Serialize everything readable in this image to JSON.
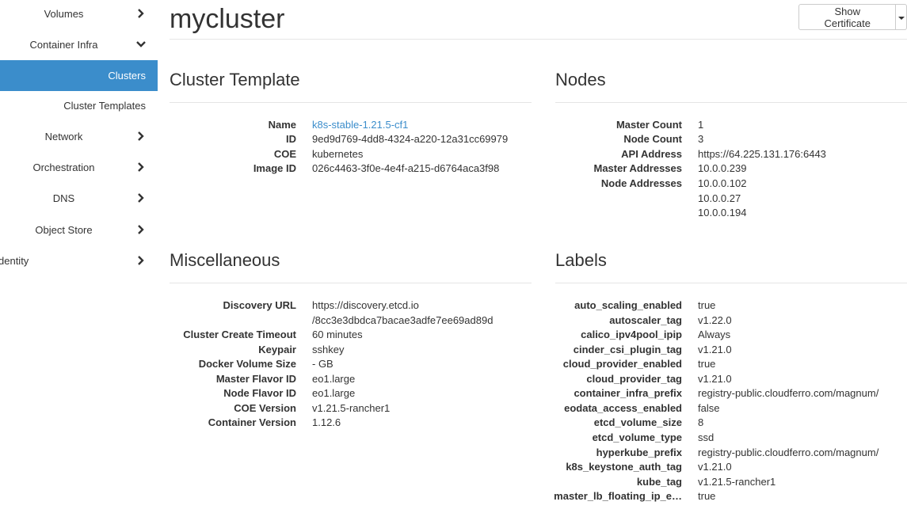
{
  "sidebar": {
    "items": [
      {
        "label": "Volumes",
        "chevron": "right"
      },
      {
        "label": "Container Infra",
        "chevron": "down"
      },
      {
        "label": "Clusters",
        "active": true
      },
      {
        "label": "Cluster Templates"
      },
      {
        "label": "Network",
        "chevron": "right"
      },
      {
        "label": "Orchestration",
        "chevron": "right"
      },
      {
        "label": "DNS",
        "chevron": "right"
      },
      {
        "label": "Object Store",
        "chevron": "right"
      },
      {
        "label": "dentity",
        "chevron": "right"
      }
    ]
  },
  "page": {
    "title": "mycluster",
    "show_certificate": "Show Certificate"
  },
  "cluster_template": {
    "title": "Cluster Template",
    "rows": [
      {
        "label": "Name",
        "value": "k8s-stable-1.21.5-cf1",
        "link": true
      },
      {
        "label": "ID",
        "value": "9ed9d769-4dd8-4324-a220-12a31cc69979"
      },
      {
        "label": "COE",
        "value": "kubernetes"
      },
      {
        "label": "Image ID",
        "value": "026c4463-3f0e-4e4f-a215-d6764aca3f98"
      }
    ]
  },
  "nodes": {
    "title": "Nodes",
    "master_count_label": "Master Count",
    "master_count": "1",
    "node_count_label": "Node Count",
    "node_count": "3",
    "api_address_label": "API Address",
    "api_address": "https://64.225.131.176:6443",
    "master_addresses_label": "Master Addresses",
    "master_addresses": [
      "10.0.0.239"
    ],
    "node_addresses_label": "Node Addresses",
    "node_addresses": [
      "10.0.0.102",
      "10.0.0.27",
      "10.0.0.194"
    ]
  },
  "misc": {
    "title": "Miscellaneous",
    "discovery_url_label": "Discovery URL",
    "discovery_url_line1": "https://discovery.etcd.io",
    "discovery_url_line2": "/8cc3e3dbdca7bacae3adfe7ee69ad89d",
    "rows": [
      {
        "label": "Cluster Create Timeout",
        "value": "60 minutes"
      },
      {
        "label": "Keypair",
        "value": "sshkey"
      },
      {
        "label": "Docker Volume Size",
        "value": "- GB"
      },
      {
        "label": "Master Flavor ID",
        "value": "eo1.large"
      },
      {
        "label": "Node Flavor ID",
        "value": "eo1.large"
      },
      {
        "label": "COE Version",
        "value": "v1.21.5-rancher1"
      },
      {
        "label": "Container Version",
        "value": "1.12.6"
      }
    ]
  },
  "labels": {
    "title": "Labels",
    "rows": [
      {
        "label": "auto_scaling_enabled",
        "value": "true"
      },
      {
        "label": "autoscaler_tag",
        "value": "v1.22.0"
      },
      {
        "label": "calico_ipv4pool_ipip",
        "value": "Always"
      },
      {
        "label": "cinder_csi_plugin_tag",
        "value": "v1.21.0"
      },
      {
        "label": "cloud_provider_enabled",
        "value": "true"
      },
      {
        "label": "cloud_provider_tag",
        "value": "v1.21.0"
      },
      {
        "label": "container_infra_prefix",
        "value": "registry-public.cloudferro.com/magnum/"
      },
      {
        "label": "eodata_access_enabled",
        "value": "false"
      },
      {
        "label": "etcd_volume_size",
        "value": "8"
      },
      {
        "label": "etcd_volume_type",
        "value": "ssd"
      },
      {
        "label": "hyperkube_prefix",
        "value": "registry-public.cloudferro.com/magnum/"
      },
      {
        "label": "k8s_keystone_auth_tag",
        "value": "v1.21.0"
      },
      {
        "label": "kube_tag",
        "value": "v1.21.5-rancher1"
      },
      {
        "label": "master_lb_floating_ip_e…",
        "value": "true"
      }
    ]
  },
  "colors": {
    "accent": "#3b8dcb",
    "text": "#333333",
    "rule": "#e5e5e5"
  }
}
